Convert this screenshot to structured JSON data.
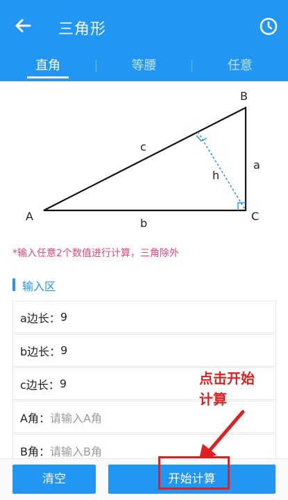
{
  "header": {
    "title": "三角形",
    "back_icon": "arrow-left-icon",
    "history_icon": "clock-icon"
  },
  "tabs": [
    {
      "label": "直角",
      "active": true
    },
    {
      "label": "等腰",
      "active": false
    },
    {
      "label": "任意",
      "active": false
    }
  ],
  "diagram": {
    "vertex_a": "A",
    "vertex_b": "B",
    "vertex_c": "C",
    "side_a": "a",
    "side_b": "b",
    "side_c": "c",
    "height": "h"
  },
  "hint": "*输入任意2个数值进行计算，三角除外",
  "section_title": "输入区",
  "fields": [
    {
      "label": "a边长：",
      "value": "9",
      "placeholder": false
    },
    {
      "label": "b边长：",
      "value": "9",
      "placeholder": false
    },
    {
      "label": "c边长：",
      "value": "9",
      "placeholder": false
    },
    {
      "label": "A角：",
      "value": "请输入A角",
      "placeholder": true
    },
    {
      "label": "B角：",
      "value": "请输入B角",
      "placeholder": true
    }
  ],
  "annotation": {
    "line1": "点击开始",
    "line2": "计算"
  },
  "buttons": {
    "clear": "清空",
    "start": "开始计算"
  },
  "colors": {
    "primary": "#2196f3",
    "hint": "#e8457a",
    "annotation": "#e02020"
  }
}
